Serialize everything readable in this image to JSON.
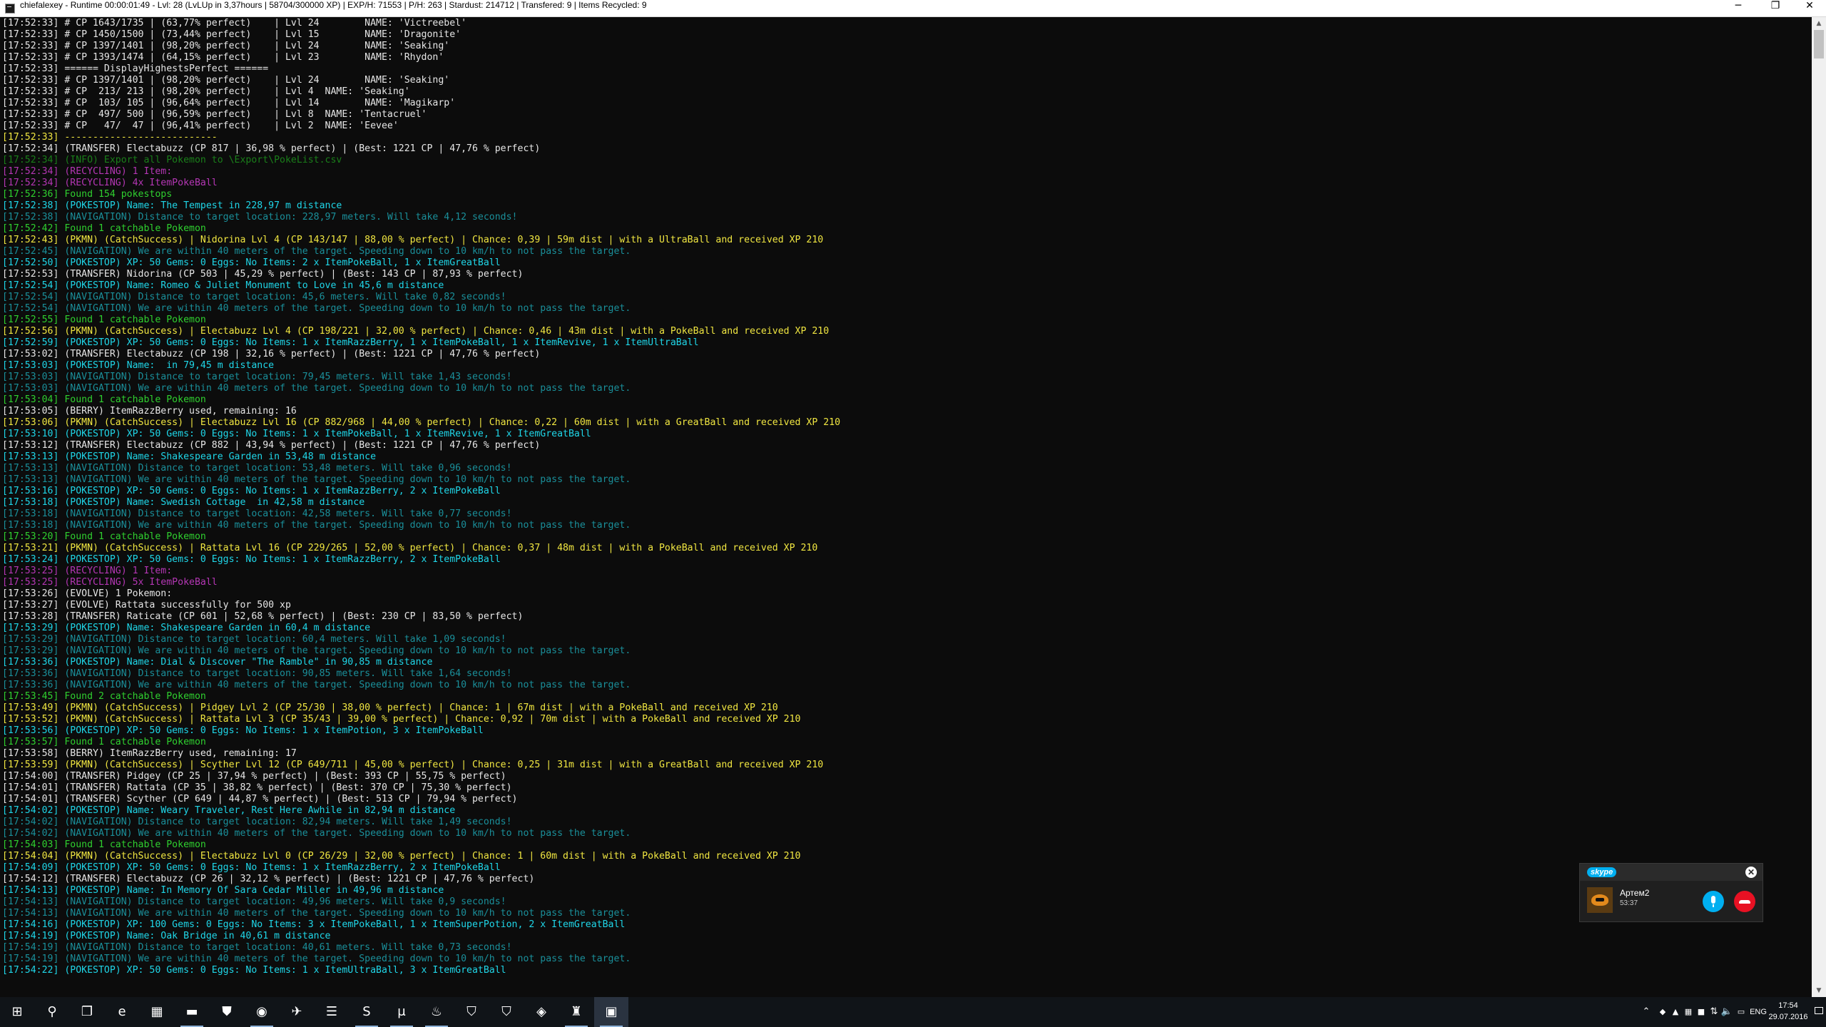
{
  "window": {
    "title": "chiefalexey - Runtime 00:00:01:49 - Lvl: 28 (LvLUp in 3,37hours | 58704/300000 XP) | EXP/H: 71553 | P/H: 263 | Stardust: 214712 | Transfered: 9 | Items Recycled: 9",
    "minimize": "─",
    "maximize": "❐",
    "close": "✕"
  },
  "colors": {
    "white": "#e6e6e6",
    "yellow": "#f0e641",
    "green": "#2fd02f",
    "cyan": "#1fd6e8",
    "dim_cyan": "#1a8f9a",
    "magenta": "#b436b4",
    "dark_green": "#1a7f1a"
  },
  "console": {
    "lines": [
      {
        "text": "[17:52:33] # CP 1643/1735 | (63,77% perfect)    | Lvl 24        NAME: 'Victreebel'",
        "color": "white"
      },
      {
        "text": "[17:52:33] # CP 1450/1500 | (73,44% perfect)    | Lvl 15        NAME: 'Dragonite'",
        "color": "white"
      },
      {
        "text": "[17:52:33] # CP 1397/1401 | (98,20% perfect)    | Lvl 24        NAME: 'Seaking'",
        "color": "white"
      },
      {
        "text": "[17:52:33] # CP 1393/1474 | (64,15% perfect)    | Lvl 23        NAME: 'Rhydon'",
        "color": "white"
      },
      {
        "text": "[17:52:33] ====== DisplayHighestsPerfect ======",
        "color": "white"
      },
      {
        "text": "[17:52:33] # CP 1397/1401 | (98,20% perfect)    | Lvl 24        NAME: 'Seaking'",
        "color": "white"
      },
      {
        "text": "[17:52:33] # CP  213/ 213 | (98,20% perfect)    | Lvl 4  NAME: 'Seaking'",
        "color": "white"
      },
      {
        "text": "[17:52:33] # CP  103/ 105 | (96,64% perfect)    | Lvl 14        NAME: 'Magikarp'",
        "color": "white"
      },
      {
        "text": "[17:52:33] # CP  497/ 500 | (96,59% perfect)    | Lvl 8  NAME: 'Tentacruel'",
        "color": "white"
      },
      {
        "text": "[17:52:33] # CP   47/  47 | (96,41% perfect)    | Lvl 2  NAME: 'Eevee'",
        "color": "white"
      },
      {
        "text": "[17:52:33] ---------------------------",
        "color": "yellow"
      },
      {
        "text": "[17:52:34] (TRANSFER) Electabuzz (CP 817 | 36,98 % perfect) | (Best: 1221 CP | 47,76 % perfect)",
        "color": "white"
      },
      {
        "text": "[17:52:34] (INFO) Export all Pokemon to \\Export\\PokeList.csv",
        "color": "dark_green"
      },
      {
        "text": "[17:52:34] (RECYCLING) 1 Item:",
        "color": "magenta"
      },
      {
        "text": "[17:52:34] (RECYCLING) 4x ItemPokeBall",
        "color": "magenta"
      },
      {
        "text": "[17:52:36] Found 154 pokestops",
        "color": "green"
      },
      {
        "text": "[17:52:38] (POKESTOP) Name: The Tempest in 228,97 m distance",
        "color": "cyan"
      },
      {
        "text": "[17:52:38] (NAVIGATION) Distance to target location: 228,97 meters. Will take 4,12 seconds!",
        "color": "dim_cyan"
      },
      {
        "text": "[17:52:42] Found 1 catchable Pokemon",
        "color": "green"
      },
      {
        "text": "[17:52:43] (PKMN) (CatchSuccess) | Nidorina Lvl 4 (CP 143/147 | 88,00 % perfect) | Chance: 0,39 | 59m dist | with a UltraBall and received XP 210",
        "color": "yellow"
      },
      {
        "text": "[17:52:45] (NAVIGATION) We are within 40 meters of the target. Speeding down to 10 km/h to not pass the target.",
        "color": "dim_cyan"
      },
      {
        "text": "[17:52:50] (POKESTOP) XP: 50 Gems: 0 Eggs: No Items: 2 x ItemPokeBall, 1 x ItemGreatBall",
        "color": "cyan"
      },
      {
        "text": "[17:52:53] (TRANSFER) Nidorina (CP 503 | 45,29 % perfect) | (Best: 143 CP | 87,93 % perfect)",
        "color": "white"
      },
      {
        "text": "[17:52:54] (POKESTOP) Name: Romeo & Juliet Monument to Love in 45,6 m distance",
        "color": "cyan"
      },
      {
        "text": "[17:52:54] (NAVIGATION) Distance to target location: 45,6 meters. Will take 0,82 seconds!",
        "color": "dim_cyan"
      },
      {
        "text": "[17:52:54] (NAVIGATION) We are within 40 meters of the target. Speeding down to 10 km/h to not pass the target.",
        "color": "dim_cyan"
      },
      {
        "text": "[17:52:55] Found 1 catchable Pokemon",
        "color": "green"
      },
      {
        "text": "[17:52:56] (PKMN) (CatchSuccess) | Electabuzz Lvl 4 (CP 198/221 | 32,00 % perfect) | Chance: 0,46 | 43m dist | with a PokeBall and received XP 210",
        "color": "yellow"
      },
      {
        "text": "[17:52:59] (POKESTOP) XP: 50 Gems: 0 Eggs: No Items: 1 x ItemRazzBerry, 1 x ItemPokeBall, 1 x ItemRevive, 1 x ItemUltraBall",
        "color": "cyan"
      },
      {
        "text": "[17:53:02] (TRANSFER) Electabuzz (CP 198 | 32,16 % perfect) | (Best: 1221 CP | 47,76 % perfect)",
        "color": "white"
      },
      {
        "text": "[17:53:03] (POKESTOP) Name:  in 79,45 m distance",
        "color": "cyan"
      },
      {
        "text": "[17:53:03] (NAVIGATION) Distance to target location: 79,45 meters. Will take 1,43 seconds!",
        "color": "dim_cyan"
      },
      {
        "text": "[17:53:03] (NAVIGATION) We are within 40 meters of the target. Speeding down to 10 km/h to not pass the target.",
        "color": "dim_cyan"
      },
      {
        "text": "[17:53:04] Found 1 catchable Pokemon",
        "color": "green"
      },
      {
        "text": "[17:53:05] (BERRY) ItemRazzBerry used, remaining: 16",
        "color": "white"
      },
      {
        "text": "[17:53:06] (PKMN) (CatchSuccess) | Electabuzz Lvl 16 (CP 882/968 | 44,00 % perfect) | Chance: 0,22 | 60m dist | with a GreatBall and received XP 210",
        "color": "yellow"
      },
      {
        "text": "[17:53:10] (POKESTOP) XP: 50 Gems: 0 Eggs: No Items: 1 x ItemPokeBall, 1 x ItemRevive, 1 x ItemGreatBall",
        "color": "cyan"
      },
      {
        "text": "[17:53:12] (TRANSFER) Electabuzz (CP 882 | 43,94 % perfect) | (Best: 1221 CP | 47,76 % perfect)",
        "color": "white"
      },
      {
        "text": "[17:53:13] (POKESTOP) Name: Shakespeare Garden in 53,48 m distance",
        "color": "cyan"
      },
      {
        "text": "[17:53:13] (NAVIGATION) Distance to target location: 53,48 meters. Will take 0,96 seconds!",
        "color": "dim_cyan"
      },
      {
        "text": "[17:53:13] (NAVIGATION) We are within 40 meters of the target. Speeding down to 10 km/h to not pass the target.",
        "color": "dim_cyan"
      },
      {
        "text": "[17:53:16] (POKESTOP) XP: 50 Gems: 0 Eggs: No Items: 1 x ItemRazzBerry, 2 x ItemPokeBall",
        "color": "cyan"
      },
      {
        "text": "[17:53:18] (POKESTOP) Name: Swedish Cottage  in 42,58 m distance",
        "color": "cyan"
      },
      {
        "text": "[17:53:18] (NAVIGATION) Distance to target location: 42,58 meters. Will take 0,77 seconds!",
        "color": "dim_cyan"
      },
      {
        "text": "[17:53:18] (NAVIGATION) We are within 40 meters of the target. Speeding down to 10 km/h to not pass the target.",
        "color": "dim_cyan"
      },
      {
        "text": "[17:53:20] Found 1 catchable Pokemon",
        "color": "green"
      },
      {
        "text": "[17:53:21] (PKMN) (CatchSuccess) | Rattata Lvl 16 (CP 229/265 | 52,00 % perfect) | Chance: 0,37 | 48m dist | with a PokeBall and received XP 210",
        "color": "yellow"
      },
      {
        "text": "[17:53:24] (POKESTOP) XP: 50 Gems: 0 Eggs: No Items: 1 x ItemRazzBerry, 2 x ItemPokeBall",
        "color": "cyan"
      },
      {
        "text": "[17:53:25] (RECYCLING) 1 Item:",
        "color": "magenta"
      },
      {
        "text": "[17:53:25] (RECYCLING) 5x ItemPokeBall",
        "color": "magenta"
      },
      {
        "text": "[17:53:26] (EVOLVE) 1 Pokemon:",
        "color": "white"
      },
      {
        "text": "[17:53:27] (EVOLVE) Rattata successfully for 500 xp",
        "color": "white"
      },
      {
        "text": "[17:53:28] (TRANSFER) Raticate (CP 601 | 52,68 % perfect) | (Best: 230 CP | 83,50 % perfect)",
        "color": "white"
      },
      {
        "text": "[17:53:29] (POKESTOP) Name: Shakespeare Garden in 60,4 m distance",
        "color": "cyan"
      },
      {
        "text": "[17:53:29] (NAVIGATION) Distance to target location: 60,4 meters. Will take 1,09 seconds!",
        "color": "dim_cyan"
      },
      {
        "text": "[17:53:29] (NAVIGATION) We are within 40 meters of the target. Speeding down to 10 km/h to not pass the target.",
        "color": "dim_cyan"
      },
      {
        "text": "[17:53:36] (POKESTOP) Name: Dial & Discover \"The Ramble\" in 90,85 m distance",
        "color": "cyan"
      },
      {
        "text": "[17:53:36] (NAVIGATION) Distance to target location: 90,85 meters. Will take 1,64 seconds!",
        "color": "dim_cyan"
      },
      {
        "text": "[17:53:36] (NAVIGATION) We are within 40 meters of the target. Speeding down to 10 km/h to not pass the target.",
        "color": "dim_cyan"
      },
      {
        "text": "[17:53:45] Found 2 catchable Pokemon",
        "color": "green"
      },
      {
        "text": "[17:53:49] (PKMN) (CatchSuccess) | Pidgey Lvl 2 (CP 25/30 | 38,00 % perfect) | Chance: 1 | 67m dist | with a PokeBall and received XP 210",
        "color": "yellow"
      },
      {
        "text": "[17:53:52] (PKMN) (CatchSuccess) | Rattata Lvl 3 (CP 35/43 | 39,00 % perfect) | Chance: 0,92 | 70m dist | with a PokeBall and received XP 210",
        "color": "yellow"
      },
      {
        "text": "[17:53:56] (POKESTOP) XP: 50 Gems: 0 Eggs: No Items: 1 x ItemPotion, 3 x ItemPokeBall",
        "color": "cyan"
      },
      {
        "text": "[17:53:57] Found 1 catchable Pokemon",
        "color": "green"
      },
      {
        "text": "[17:53:58] (BERRY) ItemRazzBerry used, remaining: 17",
        "color": "white"
      },
      {
        "text": "[17:53:59] (PKMN) (CatchSuccess) | Scyther Lvl 12 (CP 649/711 | 45,00 % perfect) | Chance: 0,25 | 31m dist | with a GreatBall and received XP 210",
        "color": "yellow"
      },
      {
        "text": "[17:54:00] (TRANSFER) Pidgey (CP 25 | 37,94 % perfect) | (Best: 393 CP | 55,75 % perfect)",
        "color": "white"
      },
      {
        "text": "[17:54:01] (TRANSFER) Rattata (CP 35 | 38,82 % perfect) | (Best: 370 CP | 75,30 % perfect)",
        "color": "white"
      },
      {
        "text": "[17:54:01] (TRANSFER) Scyther (CP 649 | 44,87 % perfect) | (Best: 513 CP | 79,94 % perfect)",
        "color": "white"
      },
      {
        "text": "[17:54:02] (POKESTOP) Name: Weary Traveler, Rest Here Awhile in 82,94 m distance",
        "color": "cyan"
      },
      {
        "text": "[17:54:02] (NAVIGATION) Distance to target location: 82,94 meters. Will take 1,49 seconds!",
        "color": "dim_cyan"
      },
      {
        "text": "[17:54:02] (NAVIGATION) We are within 40 meters of the target. Speeding down to 10 km/h to not pass the target.",
        "color": "dim_cyan"
      },
      {
        "text": "[17:54:03] Found 1 catchable Pokemon",
        "color": "green"
      },
      {
        "text": "[17:54:04] (PKMN) (CatchSuccess) | Electabuzz Lvl 0 (CP 26/29 | 32,00 % perfect) | Chance: 1 | 60m dist | with a PokeBall and received XP 210",
        "color": "yellow"
      },
      {
        "text": "[17:54:09] (POKESTOP) XP: 50 Gems: 0 Eggs: No Items: 1 x ItemRazzBerry, 2 x ItemPokeBall",
        "color": "cyan"
      },
      {
        "text": "[17:54:12] (TRANSFER) Electabuzz (CP 26 | 32,12 % perfect) | (Best: 1221 CP | 47,76 % perfect)",
        "color": "white"
      },
      {
        "text": "[17:54:13] (POKESTOP) Name: In Memory Of Sara Cedar Miller in 49,96 m distance",
        "color": "cyan"
      },
      {
        "text": "[17:54:13] (NAVIGATION) Distance to target location: 49,96 meters. Will take 0,9 seconds!",
        "color": "dim_cyan"
      },
      {
        "text": "[17:54:13] (NAVIGATION) We are within 40 meters of the target. Speeding down to 10 km/h to not pass the target.",
        "color": "dim_cyan"
      },
      {
        "text": "[17:54:16] (POKESTOP) XP: 100 Gems: 0 Eggs: No Items: 3 x ItemPokeBall, 1 x ItemSuperPotion, 2 x ItemGreatBall",
        "color": "cyan"
      },
      {
        "text": "[17:54:19] (POKESTOP) Name: Oak Bridge in 40,61 m distance",
        "color": "cyan"
      },
      {
        "text": "[17:54:19] (NAVIGATION) Distance to target location: 40,61 meters. Will take 0,73 seconds!",
        "color": "dim_cyan"
      },
      {
        "text": "[17:54:19] (NAVIGATION) We are within 40 meters of the target. Speeding down to 10 km/h to not pass the target.",
        "color": "dim_cyan"
      },
      {
        "text": "[17:54:22] (POKESTOP) XP: 50 Gems: 0 Eggs: No Items: 1 x ItemUltraBall, 3 x ItemGreatBall",
        "color": "cyan"
      }
    ]
  },
  "scrollbar": {
    "up_icon": "▲",
    "down_icon": "▼",
    "thumb_position_fraction": 0.0,
    "thumb_size_fraction": 0.03
  },
  "skype": {
    "logo": "skype",
    "close": "✕",
    "caller_name": "Артем2",
    "call_duration": "53:37"
  },
  "taskbar": {
    "items": [
      {
        "name": "start-button",
        "icon": "windows-logo-icon",
        "glyph": "⊞",
        "open": false
      },
      {
        "name": "search-button",
        "icon": "search-icon",
        "glyph": "⚲",
        "open": false
      },
      {
        "name": "task-view-button",
        "icon": "task-view-icon",
        "glyph": "❐",
        "open": false
      },
      {
        "name": "edge-button",
        "icon": "edge-icon",
        "glyph": "e",
        "open": false
      },
      {
        "name": "calculator-button",
        "icon": "calculator-icon",
        "glyph": "▦",
        "open": false
      },
      {
        "name": "explorer-button",
        "icon": "folder-icon",
        "glyph": "▬",
        "open": true
      },
      {
        "name": "store-button",
        "icon": "store-icon",
        "glyph": "⛊",
        "open": false
      },
      {
        "name": "chrome-button",
        "icon": "chrome-icon",
        "glyph": "◉",
        "open": true
      },
      {
        "name": "app-bird-button",
        "icon": "bird-app-icon",
        "glyph": "✈",
        "open": false
      },
      {
        "name": "app-list-button",
        "icon": "list-app-icon",
        "glyph": "☰",
        "open": false
      },
      {
        "name": "skype-button",
        "icon": "skype-icon",
        "glyph": "S",
        "open": true
      },
      {
        "name": "utorrent-button",
        "icon": "utorrent-icon",
        "glyph": "μ",
        "open": true
      },
      {
        "name": "steam-button",
        "icon": "steam-icon",
        "glyph": "♨",
        "open": true
      },
      {
        "name": "app-shield-button",
        "icon": "shield-app-icon",
        "glyph": "⛉",
        "open": false
      },
      {
        "name": "app-shield2-button",
        "icon": "shield-app-icon",
        "glyph": "⛉",
        "open": false
      },
      {
        "name": "app-game-button",
        "icon": "game-app-icon",
        "glyph": "◈",
        "open": false
      },
      {
        "name": "app-tank-button",
        "icon": "tank-app-icon",
        "glyph": "♜",
        "open": true
      },
      {
        "name": "console-button",
        "icon": "console-icon",
        "glyph": "▣",
        "open": true,
        "active": true
      }
    ],
    "tray": {
      "chevron": "⌃",
      "network": "⇅",
      "volume": "🔈",
      "lang": "ENG",
      "time": "17:54",
      "date": "29.07.2016"
    }
  }
}
